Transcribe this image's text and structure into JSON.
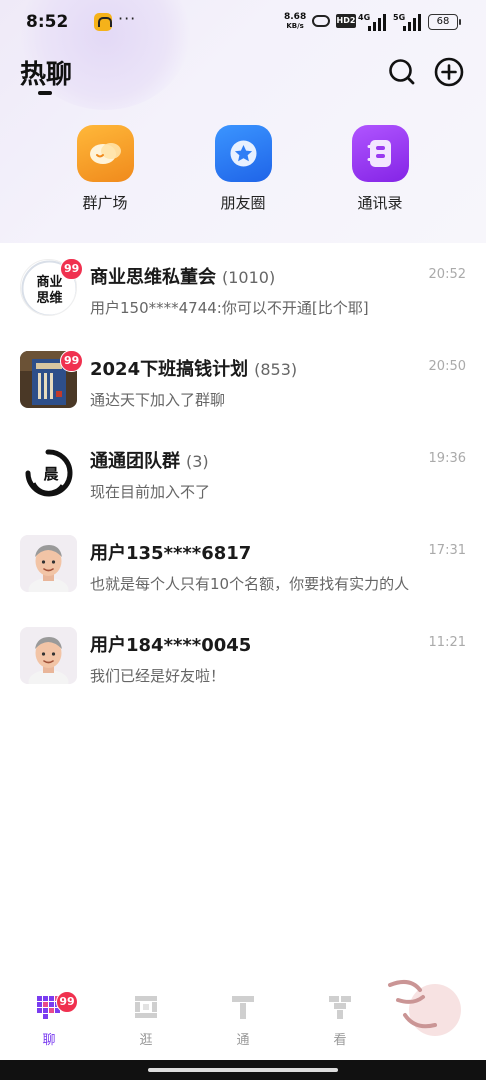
{
  "status_bar": {
    "time": "8:52",
    "more": "···",
    "net_speed_value": "8.68",
    "net_speed_unit": "KB/s",
    "hd_label": "HD2",
    "sig1_label": "4G",
    "sig2_label": "5G",
    "battery": "68"
  },
  "header": {
    "title": "热聊",
    "search_icon": "search-icon",
    "add_icon": "plus-circle-icon"
  },
  "shortcuts": [
    {
      "label": "群广场",
      "icon": "chat-bubbles-icon",
      "color": "#f5a32a"
    },
    {
      "label": "朋友圈",
      "icon": "star-circle-icon",
      "color": "#2f7ef5"
    },
    {
      "label": "通讯录",
      "icon": "contact-book-icon",
      "color": "#9a3af0"
    }
  ],
  "chats": [
    {
      "name": "商业思维私董会",
      "count": "(1010)",
      "time": "20:52",
      "message": "用户150****4744:你可以不开通[比个耶]",
      "badge": "99",
      "avatar_text": "商业思维"
    },
    {
      "name": "2024下班搞钱计划",
      "count": "(853)",
      "time": "20:50",
      "message": "通达天下加入了群聊",
      "badge": "99",
      "avatar_text": ""
    },
    {
      "name": "通通团队群",
      "count": "(3)",
      "time": "19:36",
      "message": "现在目前加入不了",
      "badge": "",
      "avatar_text": "晨"
    },
    {
      "name": "用户135****6817",
      "count": "",
      "time": "17:31",
      "message": "也就是每个人只有10个名额，你要找有实力的人",
      "badge": "",
      "avatar_text": ""
    },
    {
      "name": "用户184****0045",
      "count": "",
      "time": "11:21",
      "message": "我们已经是好友啦！",
      "badge": "",
      "avatar_text": ""
    }
  ],
  "bottom_nav": [
    {
      "label": "聊",
      "active": true,
      "badge": "99"
    },
    {
      "label": "逛",
      "active": false,
      "badge": ""
    },
    {
      "label": "通",
      "active": false,
      "badge": ""
    },
    {
      "label": "看",
      "active": false,
      "badge": ""
    }
  ],
  "colors": {
    "accent": "#7a3cf0",
    "badge": "#f0314f"
  }
}
